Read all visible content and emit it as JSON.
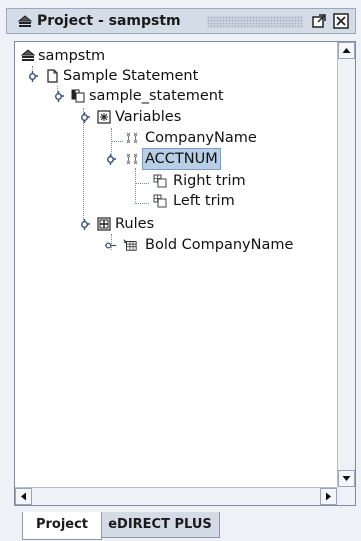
{
  "panel": {
    "title": "Project - sampstm",
    "title_icon": "project-stack-icon",
    "buttons": [
      "maximize-icon",
      "close-icon"
    ]
  },
  "tree": {
    "root": "sampstm",
    "statement": "Sample Statement",
    "child_statement": "sample_statement",
    "variables_label": "Variables",
    "variables": [
      "CompanyName",
      "ACCTNUM"
    ],
    "acctnum_children": [
      "Right trim",
      "Left trim"
    ],
    "rules_label": "Rules",
    "rules": [
      "Bold CompanyName"
    ],
    "selected": "ACCTNUM"
  },
  "tabs": [
    {
      "label": "Project",
      "active": true
    },
    {
      "label": "eDIRECT PLUS",
      "active": false
    }
  ],
  "colors": {
    "selection": "#b8cfe5",
    "titlebar": "#d4dce8",
    "background": "#eef1f6"
  }
}
